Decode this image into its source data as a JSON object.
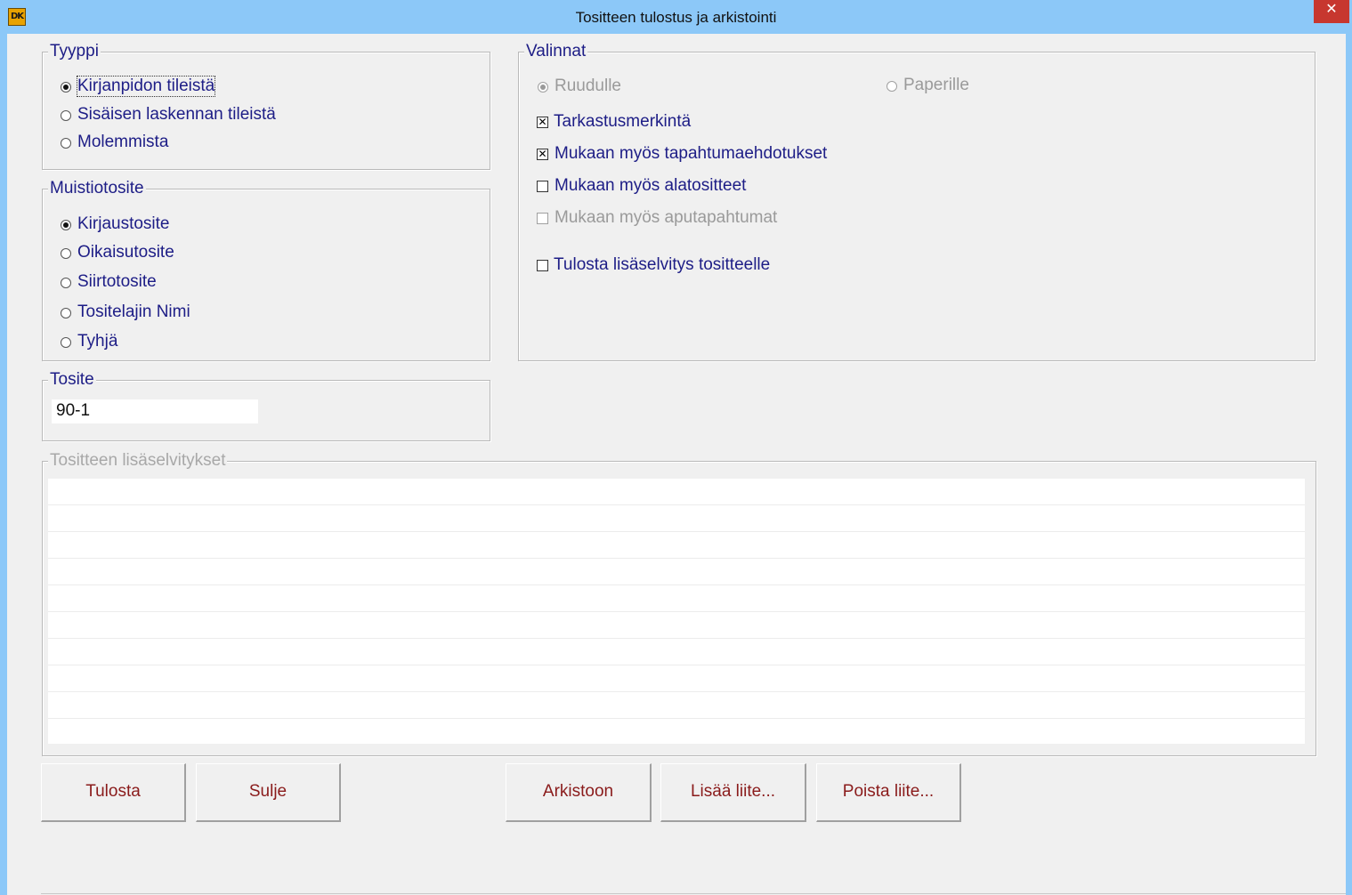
{
  "window": {
    "title": "Tositteen tulostus ja arkistointi",
    "app_icon_text": "DK",
    "close_symbol": "✕"
  },
  "tyyppi": {
    "legend": "Tyyppi",
    "options": [
      {
        "label": "Kirjanpidon tileistä",
        "checked": true
      },
      {
        "label": "Sisäisen laskennan tileistä",
        "checked": false
      },
      {
        "label": "Molemmista",
        "checked": false
      }
    ]
  },
  "muistiotosite": {
    "legend": "Muistiotosite",
    "options": [
      {
        "label": "Kirjaustosite",
        "checked": true
      },
      {
        "label": "Oikaisutosite",
        "checked": false
      },
      {
        "label": "Siirtotosite",
        "checked": false
      },
      {
        "label": "Tositelajin Nimi",
        "checked": false
      },
      {
        "label": "Tyhjä",
        "checked": false
      }
    ]
  },
  "tosite": {
    "legend": "Tosite",
    "value": "90-1"
  },
  "valinnat": {
    "legend": "Valinnat",
    "output": [
      {
        "label": "Ruudulle",
        "checked": true,
        "disabled": true
      },
      {
        "label": "Paperille",
        "checked": false,
        "disabled": true
      }
    ],
    "checks": [
      {
        "label": "Tarkastusmerkintä",
        "checked": true,
        "disabled": false
      },
      {
        "label": "Mukaan myös tapahtumaehdotukset",
        "checked": true,
        "disabled": false
      },
      {
        "label": "Mukaan myös alatositteet",
        "checked": false,
        "disabled": false
      },
      {
        "label": "Mukaan myös aputapahtumat",
        "checked": false,
        "disabled": true
      },
      {
        "label": "Tulosta lisäselvitys tositteelle",
        "checked": false,
        "disabled": false
      }
    ]
  },
  "lisaselvitykset": {
    "legend": "Tositteen lisäselvitykset"
  },
  "buttons": {
    "tulosta": "Tulosta",
    "sulje": "Sulje",
    "arkistoon": "Arkistoon",
    "lisaa_liite": "Lisää liite...",
    "poista_liite": "Poista liite..."
  }
}
